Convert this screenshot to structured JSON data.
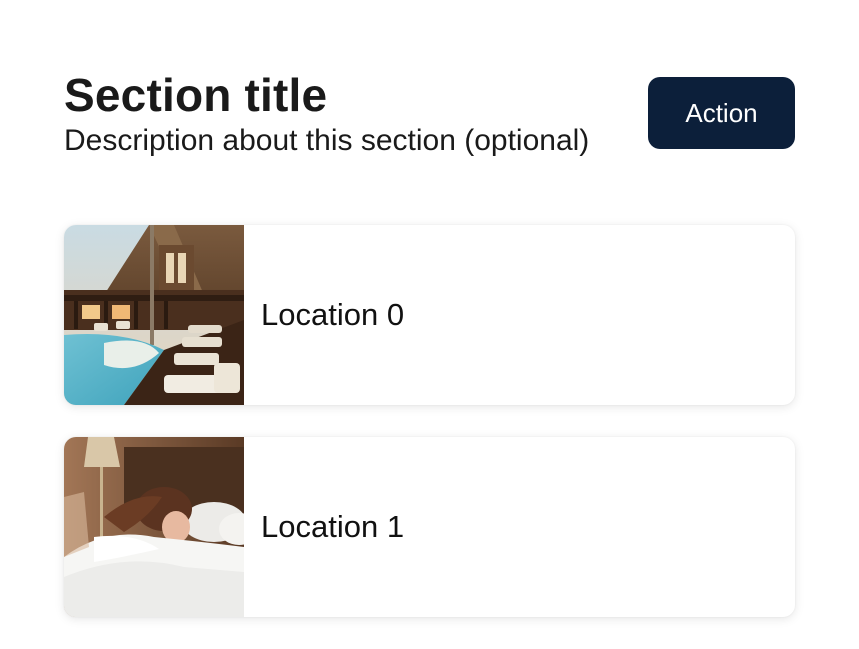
{
  "section": {
    "title": "Section title",
    "description": "Description about this section (optional)",
    "action_label": "Action"
  },
  "locations": [
    {
      "label": "Location 0",
      "image": "resort-pool-photo"
    },
    {
      "label": "Location 1",
      "image": "person-in-bed-photo"
    }
  ],
  "colors": {
    "action_background": "#0c1f3a",
    "action_text": "#ffffff",
    "card_background": "#ffffff"
  }
}
